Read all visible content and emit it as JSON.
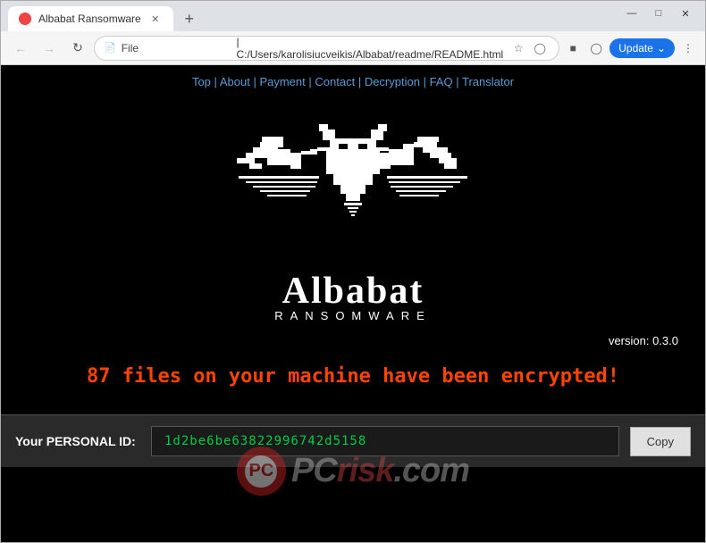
{
  "browser": {
    "tab": {
      "title": "Albabat Ransomware",
      "favicon_color": "#cc3333"
    },
    "window_controls": {
      "minimize": "—",
      "maximize": "□",
      "close": "✕"
    },
    "address_bar": {
      "protocol": "File",
      "url": "C:/Users/karolisiucveikis/Albabat/readme/README.html"
    },
    "update_button": "Update"
  },
  "nav_links": {
    "items": [
      "Top",
      "About",
      "Payment",
      "Contact",
      "Decryption",
      "FAQ",
      "Translator"
    ],
    "separator": "|"
  },
  "ransomware": {
    "title": "Albabat",
    "subtitle": "RANSOMWARE",
    "version_label": "version:",
    "version_value": "0.3.0",
    "encrypted_message": "87 files on your machine have been encrypted!",
    "personal_id_label": "Your PERSONAL ID:",
    "personal_id_value": "1d2be6be63822996742d5158",
    "copy_button": "Copy"
  },
  "watermark": {
    "text_before": "PC",
    "text_highlight": "risk",
    "text_after": ".com"
  },
  "colors": {
    "red_text": "#ff4400",
    "id_green": "#00cc44",
    "link_blue": "#5b9bd5"
  }
}
